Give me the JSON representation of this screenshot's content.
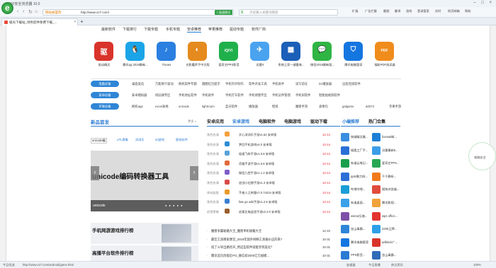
{
  "browser": {
    "title": "360安全浏览器 10.0",
    "window_buttons": "– □ ×",
    "nav": {
      "back": "‹",
      "forward": "›",
      "refresh": "↻",
      "home": "⌂"
    },
    "security_label": "网站被篡改",
    "url": "http://www.xz7.com/",
    "speed_label": "7 极速模式",
    "search_engine": "S",
    "search_placeholder": "点此输入关键词搜索",
    "tools": [
      "扩展",
      "广告拦截",
      "截图",
      "翻译",
      "游戏",
      "登录管家",
      "实时",
      "网页邮箱",
      "帮助"
    ],
    "tab_title": "极光下载站_绿色软件免费下载_...",
    "tab_close": "×",
    "new_tab": "+",
    "float_label": "电脑安全",
    "status": {
      "left": "今日优选",
      "url": "http://www.xz7.com/android/game.html",
      "right": [
        "加速器",
        "今日直播",
        "热点资讯",
        "100%"
      ]
    }
  },
  "site": {
    "nav": [
      "最新软件",
      "下载排行",
      "下载专题",
      "手机专题",
      "安卓推荐",
      "苹果推荐",
      "驱动专题",
      "软件厂商"
    ],
    "active_nav_index": 4,
    "apps": [
      {
        "label": "驱动精灵",
        "color": "#d9342b",
        "glyph": "驱"
      },
      {
        "label": "腾讯qq 2019最新...",
        "color": "#1aa5e8",
        "glyph": "🐧"
      },
      {
        "label": "iTunes",
        "color": "#2a7fe0",
        "glyph": "♪"
      },
      {
        "label": "光影魔术手中文版",
        "color": "#e58a1e",
        "glyph": "◐"
      },
      {
        "label": "爱奇艺PPS影音",
        "color": "#20b04b",
        "glyph": "iQIYI"
      },
      {
        "label": "迅雷X",
        "color": "#4aa3ef",
        "glyph": "✈"
      },
      {
        "label": "系统之家一键重装...",
        "color": "#1b5fb8",
        "glyph": "▦"
      },
      {
        "label": "微信2019最新版...",
        "color": "#2fb544",
        "glyph": "💬"
      },
      {
        "label": "腾讯电脑管家",
        "color": "#1476e0",
        "glyph": "⛉"
      },
      {
        "label": "福昕PDF阅读器",
        "color": "#f08c1c",
        "glyph": "PDF"
      }
    ],
    "rec_rows": [
      {
        "pill": "电脑必备",
        "items": [
          "桌面美化",
          "万能网卡驱动",
          "刷机软件专题",
          "圆圈红包提示",
          "手机铃声制作",
          "软件开发工具",
          "手机助手",
          "读写验证",
          "DJ播放器",
          "远程连接软件"
        ]
      },
      {
        "pill": "安卓必备",
        "items": [
          "安卓模拟器",
          "校园通专区",
          "手机地址软件",
          "手机助手",
          "手机打车软件",
          "手机修图专区",
          "手机证件管理",
          "手机闲软件",
          "智能拍视频软件"
        ]
      },
      {
        "pill": "苹果必备",
        "items": [
          "刷机app",
          "excel表格",
          "unicode",
          "lightroom",
          "蓝牙软件",
          "播放器",
          "壁纸",
          "魔兽手游",
          "表情包",
          "galgame",
          "dd373",
          "苹果手游"
        ]
      }
    ],
    "new_games": {
      "title": "新品首发",
      "more": "更多 »",
      "tabs": [
        "unicode编",
        "LPL赛事",
        "消消乐",
        "2d游戏",
        "壁纸软件"
      ],
      "banner_title": "unicode编码转换器工具",
      "banner_caption": "unicode",
      "banner_dots": "● ● ● ● ●"
    },
    "rankings": [
      "手机网游游戏排行榜",
      "高播平台软件排行榜"
    ],
    "mid_tabs": [
      "安卓应用",
      "安卓游戏",
      "电脑软件",
      "电脑游戏",
      "驱动下载"
    ],
    "mid_active_tab": 1,
    "mid_list": [
      {
        "cat": "角色扮演",
        "name": "开心消消乐手游v1.62 安卓版",
        "date": "12-14",
        "color": "#f2a23b"
      },
      {
        "cat": "角色扮演",
        "name": "梦回手机游戏v4.0 安卓版",
        "date": "12-14",
        "color": "#2d8cd6"
      },
      {
        "cat": "角色扮演",
        "name": "极速飞车手游v1.5.8 安卓版",
        "date": "12-14",
        "color": "#5aa2d9"
      },
      {
        "cat": "角色扮演",
        "name": "奇猫手游手游v1.5.8 安卓版",
        "date": "12-14",
        "color": "#e06a3a"
      },
      {
        "cat": "角色扮演",
        "name": "微信九宫手游v1.1.3 安卓版",
        "date": "12-14",
        "color": "#7d5cc9"
      },
      {
        "cat": "角色扮演",
        "name": "逆战小红猪手游v1.3 安卓版",
        "date": "12-14",
        "color": "#d94b4b"
      },
      {
        "cat": "休闲益智",
        "name": "不夜人之刺客v7.0.74224 安卓版",
        "date": "12-14",
        "color": "#e89a2b"
      },
      {
        "cat": "角色扮演",
        "name": "fate go wiki手游v1.2.8 安卓版",
        "date": "12-14",
        "color": "#3a7fd0"
      },
      {
        "cat": "经营策略",
        "name": "创意比电益思手游v2.3.0 安卓版",
        "date": "12-14",
        "color": "#9a5e2c"
      }
    ],
    "news": [
      {
        "text": "魔兽争霸秘籍大全_魔兽单机秘籍大全",
        "date": "12-10"
      },
      {
        "text": "最佳工具哪家便宜_2018年国外网络工具报价这的来?",
        "date": "10-31"
      },
      {
        "text": "找了么导出路径开_用这些软件就能享到美化？",
        "date": "10-31"
      },
      {
        "text": "腾讯首页改版近PO_微信如2000亿元规模…",
        "date": "10-31"
      }
    ],
    "right_tabs": [
      "小编推荐",
      "热门合集"
    ],
    "right_items": [
      {
        "name": "按键精灵最...",
        "color": "#3a8de0"
      },
      {
        "name": "foxmail邮...",
        "color": "#1c7fd6"
      },
      {
        "name": "搜狐工厂手...",
        "color": "#2b6fd6"
      },
      {
        "name": "迅雷最新5...",
        "color": "#3b9ee8"
      },
      {
        "name": "有道云笔记...",
        "color": "#1aa04b"
      },
      {
        "name": "爱奇艺PPS...",
        "color": "#28a853"
      },
      {
        "name": "pptv聚力网...",
        "color": "#2b6fd6"
      },
      {
        "name": "千千静听...",
        "color": "#f17b1b"
      },
      {
        "name": "哔哩哔哩...",
        "color": "#1a9ed6"
      },
      {
        "name": "搜狗浏览器...",
        "color": "#e04c3b"
      },
      {
        "name": "有道桌面...",
        "color": "#3aa0e8"
      },
      {
        "name": "腾讯影视...",
        "color": "#f0a23b"
      },
      {
        "name": "winrar压缩...",
        "color": "#7d4fa8"
      },
      {
        "name": "wps office...",
        "color": "#e3342f"
      },
      {
        "name": "金山毒霸...",
        "color": "#2f86d6"
      },
      {
        "name": "2345王牌...",
        "color": "#2f9fe8"
      },
      {
        "name": "腾讯电脑管家",
        "color": "#1476e0"
      },
      {
        "name": "adblock广...",
        "color": "#d9342b"
      },
      {
        "name": "PPS影音...",
        "color": "#2a7bd3"
      },
      {
        "name": "金山毒霸...",
        "color": "#2f6cb8"
      }
    ]
  }
}
